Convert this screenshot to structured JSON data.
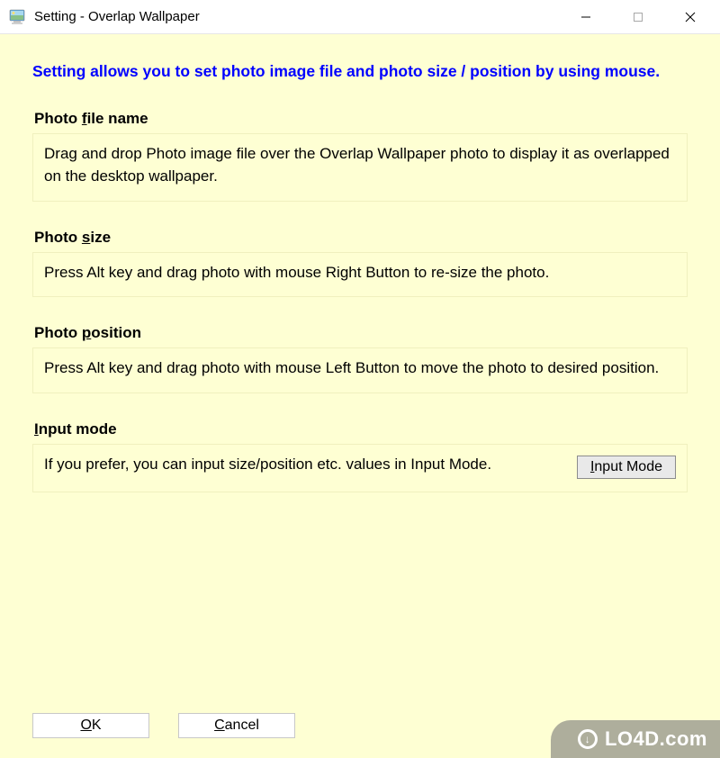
{
  "window": {
    "title": "Setting - Overlap Wallpaper"
  },
  "headline": "Setting allows you to set photo image file and photo size / position by using mouse.",
  "sections": {
    "photo_file": {
      "title_prefix": "Photo ",
      "title_ul": "f",
      "title_suffix": "ile name",
      "body": "Drag and drop Photo image file over the Overlap Wallpaper photo to display it as overlapped on the desktop wallpaper."
    },
    "photo_size": {
      "title_prefix": "Photo ",
      "title_ul": "s",
      "title_suffix": "ize",
      "body": "Press Alt key and drag photo with mouse Right Button to re-size the photo."
    },
    "photo_position": {
      "title_prefix": "Photo ",
      "title_ul": "p",
      "title_suffix": "osition",
      "body": "Press Alt key and drag photo with mouse Left Button to move the photo to desired position."
    },
    "input_mode": {
      "title_prefix": "",
      "title_ul": "I",
      "title_suffix": "nput mode",
      "body": "If you prefer, you can input size/position etc. values in Input Mode.",
      "button_ul": "I",
      "button_rest": "nput Mode"
    }
  },
  "footer": {
    "ok_ul": "O",
    "ok_rest": "K",
    "cancel_ul": "C",
    "cancel_rest": "ancel"
  },
  "watermark": "LO4D.com"
}
